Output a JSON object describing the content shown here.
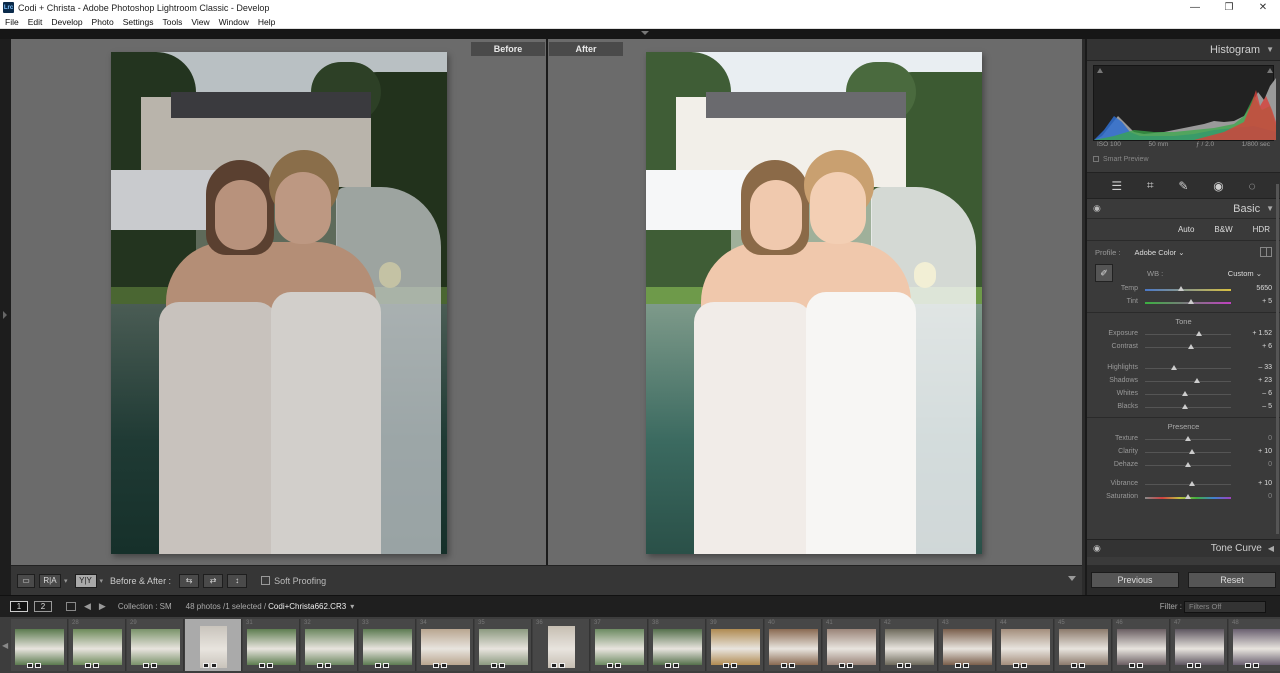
{
  "window": {
    "title": "Codi + Christa - Adobe Photoshop Lightroom Classic - Develop",
    "app_icon": "Lrc",
    "controls": [
      "—",
      "❐",
      "✕"
    ]
  },
  "menu": [
    "File",
    "Edit",
    "Develop",
    "Photo",
    "Settings",
    "Tools",
    "View",
    "Window",
    "Help"
  ],
  "view": {
    "before_label": "Before",
    "after_label": "After"
  },
  "toolbar": {
    "before_after_label": "Before & After :",
    "soft_proofing_label": "Soft Proofing",
    "mode_yy": "Y|Y"
  },
  "histogram": {
    "title": "Histogram",
    "iso": "ISO 100",
    "focal": "50 mm",
    "aperture": "ƒ / 2.0",
    "shutter": "1/800 sec",
    "smart_preview": "Smart Preview"
  },
  "basic": {
    "title": "Basic",
    "treatments": [
      "Auto",
      "B&W",
      "HDR"
    ],
    "profile_label": "Profile :",
    "profile_value": "Adobe Color",
    "wb_label": "WB :",
    "wb_value": "Custom",
    "tone_label": "Tone",
    "presence_label": "Presence",
    "sliders": {
      "temp": {
        "label": "Temp",
        "value": "5650",
        "pos": 0.42
      },
      "tint": {
        "label": "Tint",
        "value": "+ 5",
        "pos": 0.53
      },
      "exposure": {
        "label": "Exposure",
        "value": "+ 1.52",
        "pos": 0.63
      },
      "contrast": {
        "label": "Contrast",
        "value": "+ 6",
        "pos": 0.53
      },
      "highlights": {
        "label": "Highlights",
        "value": "– 33",
        "pos": 0.34
      },
      "shadows": {
        "label": "Shadows",
        "value": "+ 23",
        "pos": 0.61
      },
      "whites": {
        "label": "Whites",
        "value": "– 6",
        "pos": 0.47
      },
      "blacks": {
        "label": "Blacks",
        "value": "– 5",
        "pos": 0.47
      },
      "texture": {
        "label": "Texture",
        "value": "0",
        "pos": 0.5
      },
      "clarity": {
        "label": "Clarity",
        "value": "+ 10",
        "pos": 0.55
      },
      "dehaze": {
        "label": "Dehaze",
        "value": "0",
        "pos": 0.5
      },
      "vibrance": {
        "label": "Vibrance",
        "value": "+ 10",
        "pos": 0.55
      },
      "saturation": {
        "label": "Saturation",
        "value": "0",
        "pos": 0.5
      }
    }
  },
  "tone_curve": {
    "title": "Tone Curve"
  },
  "panel_buttons": {
    "previous": "Previous",
    "reset": "Reset"
  },
  "filmstrip_nav": {
    "page1": "1",
    "page2": "2",
    "collection": "Collection : SM",
    "count": "48 photos /1 selected /",
    "filename": "Codi+Christa662.CR3",
    "filter_label": "Filter :",
    "filter_value": "Filters Off"
  },
  "filmstrip": {
    "cells": [
      {
        "num": "",
        "tone": "#5b7a4f",
        "portrait": false
      },
      {
        "num": "28",
        "tone": "#6d8a5a",
        "portrait": false
      },
      {
        "num": "29",
        "tone": "#7a936a",
        "portrait": false
      },
      {
        "num": "",
        "tone": "#c9c4bc",
        "portrait": true,
        "selected": true
      },
      {
        "num": "31",
        "tone": "#5e7d50",
        "portrait": false
      },
      {
        "num": "32",
        "tone": "#6c8760",
        "portrait": false
      },
      {
        "num": "33",
        "tone": "#5d7b52",
        "portrait": false
      },
      {
        "num": "34",
        "tone": "#b9a690",
        "portrait": false
      },
      {
        "num": "35",
        "tone": "#8c9a80",
        "portrait": false
      },
      {
        "num": "36",
        "tone": "#c6beb2",
        "portrait": true
      },
      {
        "num": "37",
        "tone": "#6d8b62",
        "portrait": false
      },
      {
        "num": "38",
        "tone": "#55704c",
        "portrait": false
      },
      {
        "num": "39",
        "tone": "#b08b52",
        "portrait": false
      },
      {
        "num": "40",
        "tone": "#8a6a52",
        "portrait": false
      },
      {
        "num": "41",
        "tone": "#9a8478",
        "portrait": false
      },
      {
        "num": "42",
        "tone": "#6e6a5c",
        "portrait": false
      },
      {
        "num": "43",
        "tone": "#7a5f4c",
        "portrait": false
      },
      {
        "num": "44",
        "tone": "#a48e7c",
        "portrait": false
      },
      {
        "num": "45",
        "tone": "#8c7a6c",
        "portrait": false
      },
      {
        "num": "46",
        "tone": "#6a5e62",
        "portrait": false
      },
      {
        "num": "47",
        "tone": "#5e5660",
        "portrait": false
      },
      {
        "num": "48",
        "tone": "#6a6070",
        "portrait": false
      }
    ]
  },
  "colors": {
    "panel_bg": "#3a3a3a",
    "view_bg": "#6b6b6b",
    "hist_blue": "#2f6fd0",
    "hist_green": "#3aa84a",
    "hist_red": "#d8403a"
  }
}
